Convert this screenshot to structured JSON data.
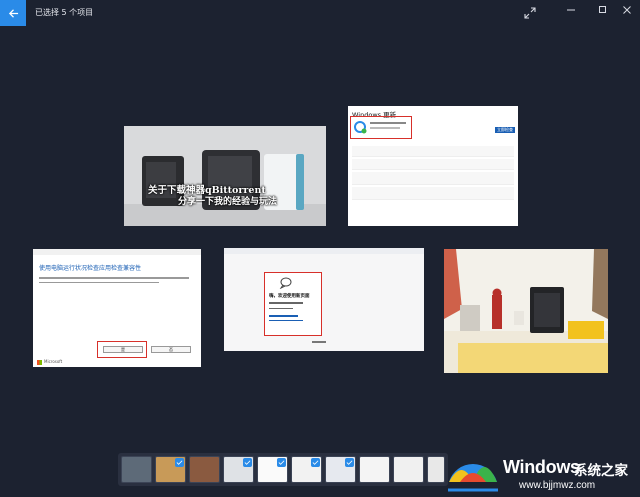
{
  "window": {
    "title": "已选择 5 个项目"
  },
  "photos": {
    "p1_caption_line1": "关于下载神器qBittorrent",
    "p1_caption_line2": "分享一下我的经验与玩法",
    "p2_header": "Windows 更新",
    "p2_button": "立即检查",
    "p3_title": "使用电脑运行状况检查应用检查兼容性",
    "p3_btn_yes": "是",
    "p3_btn_no": "否",
    "p3_footer": "Microsoft",
    "p4_heading": "嗨，欢迎使用新页面"
  },
  "filmstrip": {
    "count": 10
  },
  "watermark": {
    "brand": "Windows",
    "text": "系统之家",
    "url": "www.bjjmwz.com"
  },
  "colors": {
    "background": "#1c2230",
    "accent": "#2a8be8",
    "highlight": "#d7302a"
  }
}
